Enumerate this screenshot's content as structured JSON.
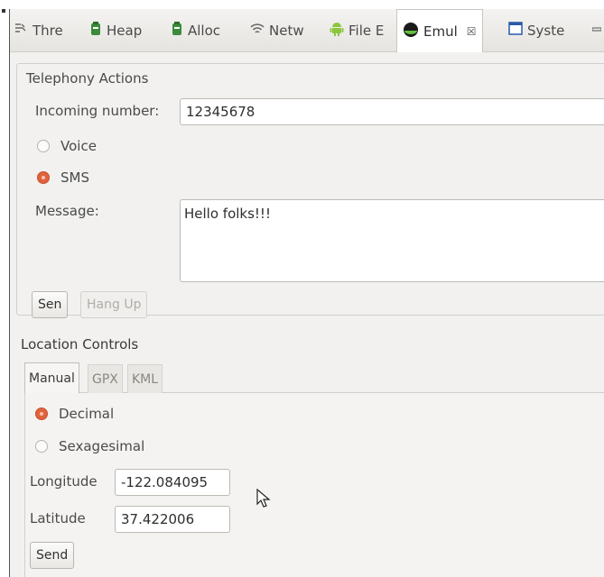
{
  "tabs": [
    {
      "label": "Thre",
      "icon": "threads-icon"
    },
    {
      "label": "Heap",
      "icon": "heap-icon"
    },
    {
      "label": "Alloc",
      "icon": "allocation-icon"
    },
    {
      "label": "Netw",
      "icon": "network-icon"
    },
    {
      "label": "File E",
      "icon": "android-icon"
    },
    {
      "label": "Emul",
      "icon": "emulator-icon",
      "active": true,
      "close": "☒"
    },
    {
      "label": "Syste",
      "icon": "window-icon"
    }
  ],
  "telephony": {
    "title": "Telephony Actions",
    "incoming_label": "Incoming number:",
    "incoming_value": "12345678",
    "voice_label": "Voice",
    "sms_label": "SMS",
    "selected": "SMS",
    "message_label": "Message:",
    "message_value": "Hello folks!!!",
    "send_label": "Sen",
    "hangup_label": "Hang Up"
  },
  "location": {
    "title": "Location Controls",
    "tabs": [
      "Manual",
      "GPX",
      "KML"
    ],
    "active_tab": "Manual",
    "decimal_label": "Decimal",
    "sexagesimal_label": "Sexagesimal",
    "selected_format": "Decimal",
    "longitude_label": "Longitude",
    "longitude_value": "-122.084095",
    "latitude_label": "Latitude",
    "latitude_value": "37.422006",
    "send_label": "Send"
  },
  "colors": {
    "radio_selected": "#e0623c",
    "panel_bg": "#f2f1f0"
  }
}
